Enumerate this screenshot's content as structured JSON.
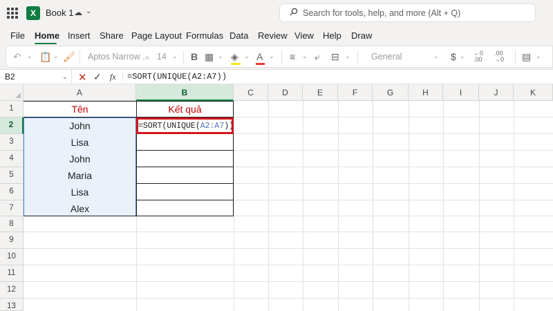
{
  "titlebar": {
    "app_icon_letter": "X",
    "doc_title": "Book 1",
    "search_placeholder": "Search for tools, help, and more (Alt + Q)"
  },
  "menu": {
    "tabs": [
      "File",
      "Home",
      "Insert",
      "Share",
      "Page Layout",
      "Formulas",
      "Data",
      "Review",
      "View",
      "Help",
      "Draw"
    ],
    "active": "Home"
  },
  "ribbon": {
    "font_name": "Aptos Narrow ...",
    "font_size": "14",
    "bold_label": "B",
    "number_format": "General",
    "currency_symbol": "$"
  },
  "formula_bar": {
    "name_box": "B2",
    "fx_label": "fx",
    "formula": "=SORT(UNIQUE(A2:A7))"
  },
  "sheet": {
    "columns": [
      "A",
      "B",
      "C",
      "D",
      "E",
      "F",
      "G",
      "H",
      "I",
      "J",
      "K"
    ],
    "rows": [
      "1",
      "2",
      "3",
      "4",
      "5",
      "6",
      "7",
      "8",
      "9",
      "10",
      "11",
      "12",
      "13"
    ],
    "selected_column": "B",
    "selected_row": "2",
    "header_a": "Tên",
    "header_b": "Kết quả",
    "names": [
      "John",
      "Lisa",
      "John",
      "Maria",
      "Lisa",
      "Alex"
    ],
    "edit_formula": {
      "prefix": "=SORT(UNIQUE(",
      "ref": "A2:A7",
      "suffix": "))"
    }
  },
  "colors": {
    "accent": "#107c41",
    "header_text": "#c00000",
    "edit_border": "#d0161b",
    "range_fill": "#eaf1fb"
  }
}
